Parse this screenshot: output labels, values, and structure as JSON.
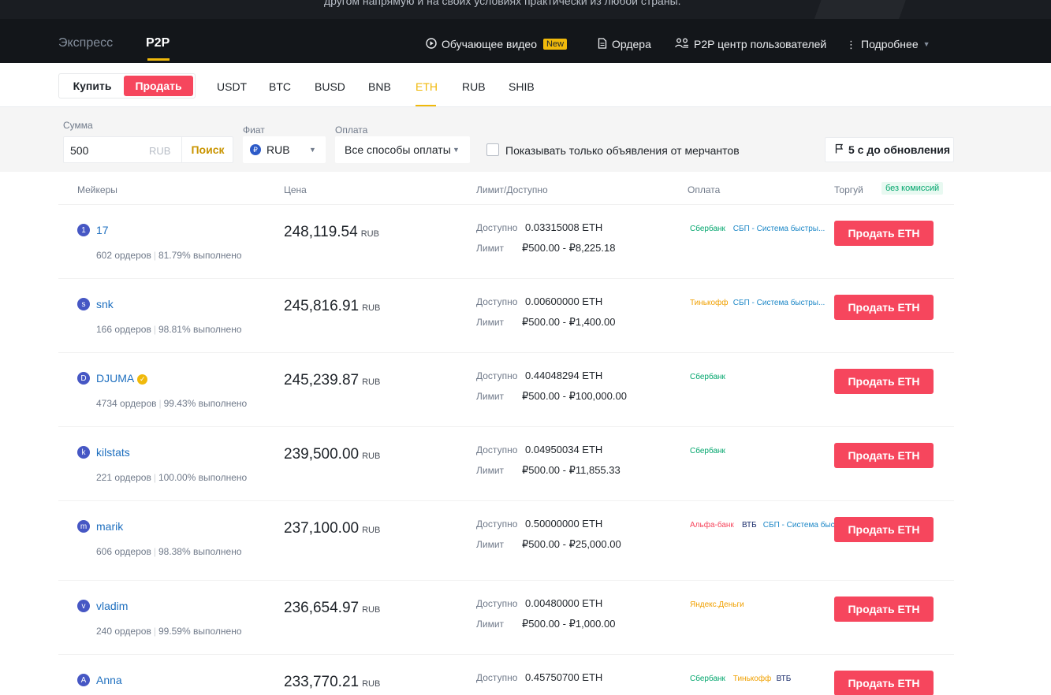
{
  "banner": {
    "text": "другом напрямую и на своих условиях практически из любой страны."
  },
  "nav": {
    "tabs": [
      "Экспресс",
      "P2P"
    ],
    "video_label": "Обучающее видео",
    "new_badge": "New",
    "orders_label": "Ордера",
    "center_label": "P2P центр пользователей",
    "more_label": "Подробнее"
  },
  "trade": {
    "buy_label": "Купить",
    "sell_label": "Продать",
    "assets": [
      "USDT",
      "BTC",
      "BUSD",
      "BNB",
      "ETH",
      "RUB",
      "SHIB"
    ],
    "active_asset": "ETH"
  },
  "filters": {
    "amount_label": "Сумма",
    "amount_value": "500",
    "amount_currency": "RUB",
    "search_label": "Поиск",
    "fiat_label": "Фиат",
    "fiat_symbol": "₽",
    "fiat_value": "RUB",
    "payment_label": "Оплата",
    "payment_value": "Все способы оплаты",
    "merchant_only_label": "Показывать только объявления от мерчантов",
    "refresh_label": "5 с до обновления"
  },
  "table": {
    "headers": {
      "makers": "Мейкеры",
      "price": "Цена",
      "limit": "Лимит/Доступно",
      "payment": "Оплата",
      "trade": "Торгуй",
      "fee_badge": "без комиссий"
    },
    "available_label": "Доступно",
    "limit_label": "Лимит",
    "orders_suffix": "ордеров",
    "completed_suffix": "выполнено",
    "rows": [
      {
        "initial": "1",
        "name": "17",
        "verified": false,
        "orders": "602",
        "completion": "81.79%",
        "price": "248,119.54",
        "currency": "RUB",
        "available": "0.03315008 ETH",
        "limit": "₽500.00 - ₽8,225.18",
        "payments": [
          {
            "name": "Сбербанк",
            "color": "green"
          },
          {
            "name": "СБП - Система быстры...",
            "color": "blue"
          }
        ],
        "button": "Продать ETH"
      },
      {
        "initial": "s",
        "name": "snk",
        "verified": false,
        "orders": "166",
        "completion": "98.81%",
        "price": "245,816.91",
        "currency": "RUB",
        "available": "0.00600000 ETH",
        "limit": "₽500.00 - ₽1,400.00",
        "payments": [
          {
            "name": "Тинькофф",
            "color": "orange"
          },
          {
            "name": "СБП - Система быстры...",
            "color": "blue"
          }
        ],
        "button": "Продать ETH"
      },
      {
        "initial": "D",
        "name": "DJUMA",
        "verified": true,
        "orders": "4734",
        "completion": "99.43%",
        "price": "245,239.87",
        "currency": "RUB",
        "available": "0.44048294 ETH",
        "limit": "₽500.00 - ₽100,000.00",
        "payments": [
          {
            "name": "Сбербанк",
            "color": "green"
          }
        ],
        "button": "Продать ETH"
      },
      {
        "initial": "k",
        "name": "kilstats",
        "verified": false,
        "orders": "221",
        "completion": "100.00%",
        "price": "239,500.00",
        "currency": "RUB",
        "available": "0.04950034 ETH",
        "limit": "₽500.00 - ₽11,855.33",
        "payments": [
          {
            "name": "Сбербанк",
            "color": "green"
          }
        ],
        "button": "Продать ETH"
      },
      {
        "initial": "m",
        "name": "marik",
        "verified": false,
        "orders": "606",
        "completion": "98.38%",
        "price": "237,100.00",
        "currency": "RUB",
        "available": "0.50000000 ETH",
        "limit": "₽500.00 - ₽25,000.00",
        "payments": [
          {
            "name": "Альфа-банк",
            "color": "red"
          },
          {
            "name": "ВТБ",
            "color": "dark"
          },
          {
            "name": "СБП - Система быстры...",
            "color": "blue"
          }
        ],
        "button": "Продать ETH"
      },
      {
        "initial": "v",
        "name": "vladim",
        "verified": false,
        "orders": "240",
        "completion": "99.59%",
        "price": "236,654.97",
        "currency": "RUB",
        "available": "0.00480000 ETH",
        "limit": "₽500.00 - ₽1,000.00",
        "payments": [
          {
            "name": "Яндекс.Деньги",
            "color": "orange"
          }
        ],
        "button": "Продать ETH"
      },
      {
        "initial": "A",
        "name": "Anna",
        "verified": false,
        "orders": "",
        "completion": "",
        "price": "233,770.21",
        "currency": "RUB",
        "available": "0.45750700 ETH",
        "limit": "",
        "payments": [
          {
            "name": "Сбербанк",
            "color": "green"
          },
          {
            "name": "Тинькофф",
            "color": "orange"
          },
          {
            "name": "ВТБ",
            "color": "dark"
          }
        ],
        "button": "Продать ETH"
      }
    ]
  },
  "colors": {
    "accent": "#f0b90b",
    "sell": "#f6465d",
    "nav_bg": "#13161a",
    "maker_link": "#1e6fbf"
  }
}
